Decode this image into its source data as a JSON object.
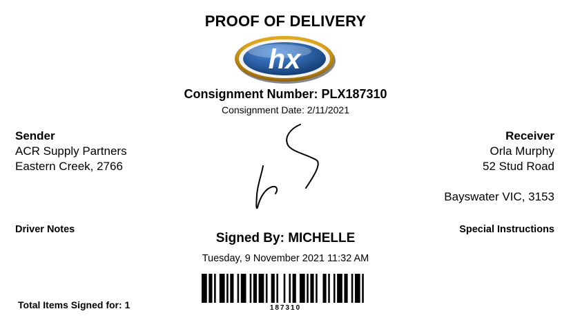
{
  "document": {
    "title": "PROOF OF DELIVERY",
    "logo_text": "hx",
    "consignment_number": "Consignment Number: PLX187310",
    "consignment_date": "Consignment Date: 2/11/2021"
  },
  "sender": {
    "heading": "Sender",
    "name": "ACR Supply Partners",
    "location": "Eastern Creek, 2766"
  },
  "receiver": {
    "heading": "Receiver",
    "name": "Orla Murphy",
    "address_line1": "52 Stud Road",
    "address_line2": "Bayswater VIC, 3153"
  },
  "notes": {
    "driver_notes": "Driver Notes",
    "special_instructions": "Special Instructions"
  },
  "signature": {
    "signed_by": "Signed By: MICHELLE",
    "signed_datetime": "Tuesday, 9 November 2021 11:32 AM"
  },
  "barcode": {
    "number": "187310"
  },
  "totals": {
    "items_signed": "Total Items Signed for: 1"
  },
  "colors": {
    "logo_blue": "#1f5fa8",
    "logo_gold": "#d9a21b"
  }
}
